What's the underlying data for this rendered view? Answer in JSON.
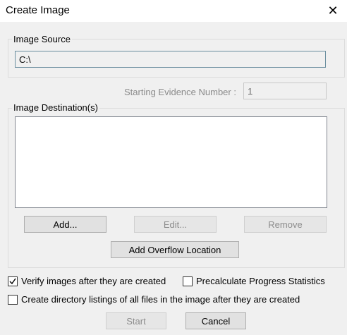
{
  "window": {
    "title": "Create Image",
    "close_icon": "close-icon"
  },
  "source": {
    "legend": "Image Source",
    "path": "C:\\"
  },
  "evidence": {
    "label": "Starting Evidence Number :",
    "value": "1"
  },
  "destination": {
    "legend": "Image Destination(s)",
    "items": [],
    "add_label": "Add...",
    "edit_label": "Edit...",
    "remove_label": "Remove",
    "overflow_label": "Add Overflow Location"
  },
  "options": {
    "verify_label": "Verify images after they are created",
    "verify_checked": true,
    "precalc_label": "Precalculate Progress Statistics",
    "precalc_checked": false,
    "dirlist_label": "Create directory listings of all files in the image after they are created",
    "dirlist_checked": false
  },
  "footer": {
    "start_label": "Start",
    "cancel_label": "Cancel"
  }
}
